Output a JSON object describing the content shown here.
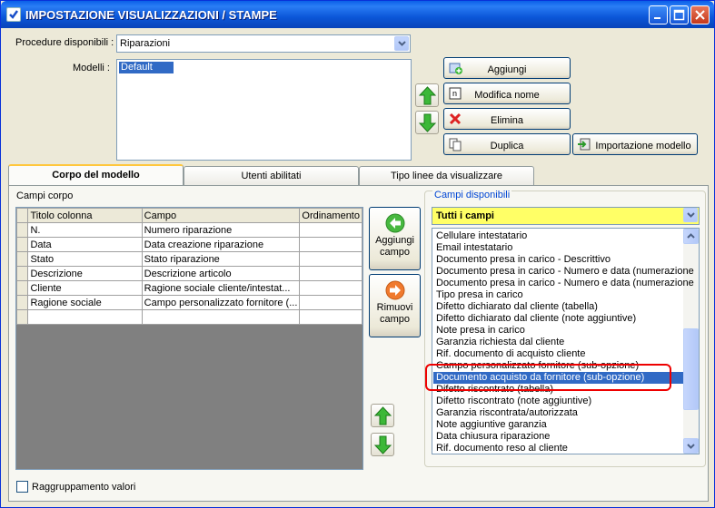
{
  "window": {
    "title": "IMPOSTAZIONE VISUALIZZAZIONI / STAMPE"
  },
  "procedure": {
    "label": "Procedure disponibili :",
    "value": "Riparazioni"
  },
  "modelli": {
    "label": "Modelli :",
    "items": [
      "Default"
    ]
  },
  "buttons": {
    "aggiungi": "Aggiungi",
    "modifica_nome": "Modifica nome",
    "elimina": "Elimina",
    "duplica": "Duplica",
    "importazione": "Importazione modello"
  },
  "tabs": [
    "Corpo del modello",
    "Utenti abilitati",
    "Tipo linee da visualizzare"
  ],
  "campi_corpo": {
    "label": "Campi corpo",
    "columns": [
      "Titolo colonna",
      "Campo",
      "Ordinamento"
    ],
    "rows": [
      [
        "N.",
        "Numero riparazione",
        ""
      ],
      [
        "Data",
        "Data creazione riparazione",
        ""
      ],
      [
        "Stato",
        "Stato riparazione",
        ""
      ],
      [
        "Descrizione",
        "Descrizione articolo",
        ""
      ],
      [
        "Cliente",
        "Ragione sociale cliente/intestat...",
        ""
      ],
      [
        "Ragione sociale",
        "Campo personalizzato fornitore (...",
        ""
      ],
      [
        "",
        "",
        ""
      ]
    ]
  },
  "actions": {
    "aggiungi_campo": [
      "Aggiungi",
      "campo"
    ],
    "rimuovi_campo": [
      "Rimuovi",
      "campo"
    ]
  },
  "campi_disponibili": {
    "label": "Campi disponibili",
    "filter": "Tutti i campi",
    "items": [
      "Cellulare intestatario",
      "Email intestatario",
      "Documento presa in carico - Descrittivo",
      "Documento presa in carico - Numero e data (numerazione",
      "Documento presa in carico - Numero e data (numerazione",
      "Tipo presa in carico",
      "Difetto dichiarato dal cliente (tabella)",
      "Difetto dichiarato dal cliente (note aggiuntive)",
      "Note presa in carico",
      "Garanzia richiesta dal cliente",
      "Rif. documento di acquisto cliente",
      "Campo personalizzato fornitore (sub-opzione)",
      "Documento acquisto da fornitore (sub-opzione)",
      "Difetto riscontrato (tabella)",
      "Difetto riscontrato (note aggiuntive)",
      "Garanzia riscontrata/autorizzata",
      "Note aggiuntive garanzia",
      "Data chiusura riparazione",
      "Rif. documento reso al cliente"
    ],
    "selected_index": 12
  },
  "raggruppamento": {
    "label": "Raggruppamento valori",
    "checked": false
  }
}
